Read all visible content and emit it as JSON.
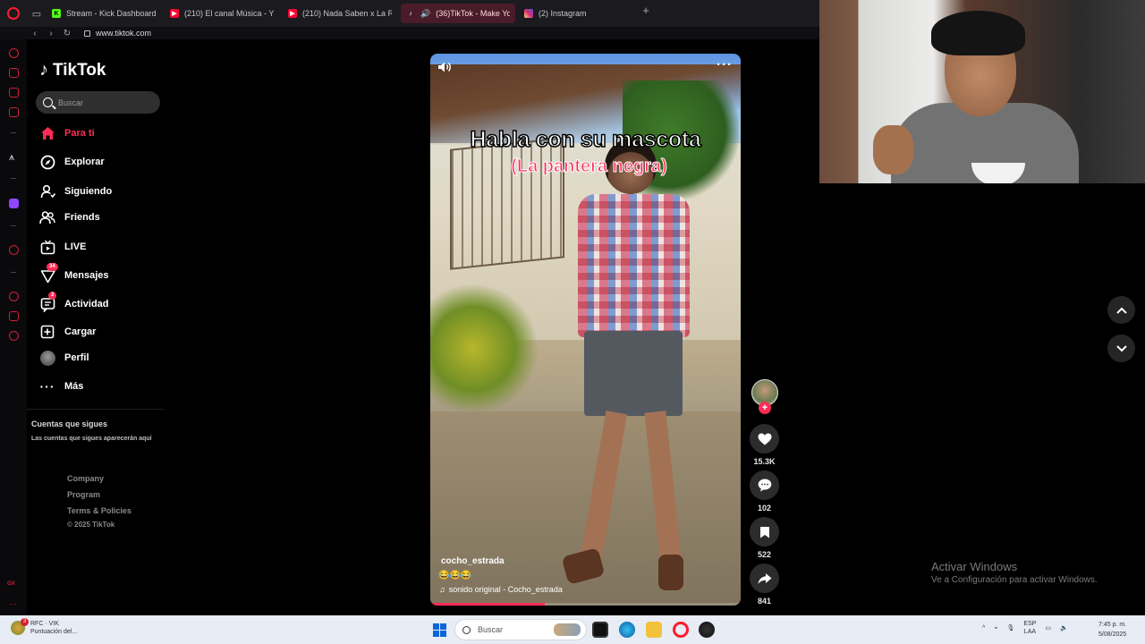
{
  "browser": {
    "tabs": [
      {
        "label": "Stream - Kick Dashboard",
        "favicon": "kick",
        "color": "#53fc18",
        "active": false
      },
      {
        "label": "(210) El canal Música - Yo",
        "favicon": "youtube",
        "color": "#ff0033",
        "active": false
      },
      {
        "label": "(210) Nada Saben x La Re",
        "favicon": "youtube",
        "color": "#ff0033",
        "active": false
      },
      {
        "label": "(36)TikTok - Make Yo",
        "favicon": "tiktok",
        "color": "#111111",
        "active": true
      },
      {
        "label": "(2) Instagram",
        "favicon": "instagram",
        "color": "#d62976",
        "active": false
      }
    ],
    "url": "www.tiktok.com"
  },
  "tiktok": {
    "brand": "TikTok",
    "search_placeholder": "Buscar",
    "nav": [
      {
        "label": "Para ti",
        "icon": "home-icon",
        "active": true
      },
      {
        "label": "Explorar",
        "icon": "compass-icon",
        "active": false
      },
      {
        "label": "Siguiendo",
        "icon": "following-icon",
        "active": false
      },
      {
        "label": "Friends",
        "icon": "friends-icon",
        "active": false
      },
      {
        "label": "LIVE",
        "icon": "live-icon",
        "active": false
      },
      {
        "label": "Mensajes",
        "icon": "messages-icon",
        "active": false,
        "badge": "34"
      },
      {
        "label": "Actividad",
        "icon": "activity-icon",
        "active": false,
        "badge": "2"
      },
      {
        "label": "Cargar",
        "icon": "upload-icon",
        "active": false
      },
      {
        "label": "Perfil",
        "icon": "profile-avatar",
        "active": false
      },
      {
        "label": "Más",
        "icon": "more-icon",
        "active": false
      }
    ],
    "following_title": "Cuentas que sigues",
    "following_desc": "Las cuentas que sigues aparecerán aquí",
    "footer": [
      "Company",
      "Program",
      "Terms & Policies"
    ],
    "copyright": "© 2025 TikTok",
    "accent": "#fe2c55"
  },
  "video": {
    "caption_title": "Habla con su mascota",
    "caption_subtitle": "(La pantera negra)",
    "author": "cocho_estrada",
    "emoji": "😂😂😂",
    "sound": "sonido original - Cocho_estrada",
    "progress": 0.37,
    "likes": "15.3K",
    "comments": "102",
    "saves": "522",
    "shares": "841"
  },
  "windows": {
    "activate_title": "Activar Windows",
    "activate_desc": "Ve a Configuración para activar Windows."
  },
  "taskbar": {
    "weather_line1": "RFC · VIK",
    "weather_line2": "Puntuación del...",
    "weather_badge": "3",
    "search_placeholder": "Buscar",
    "lang_line1": "ESP",
    "lang_line2": "LAA",
    "time": "7:45 p. m.",
    "date": "5/08/2025"
  }
}
